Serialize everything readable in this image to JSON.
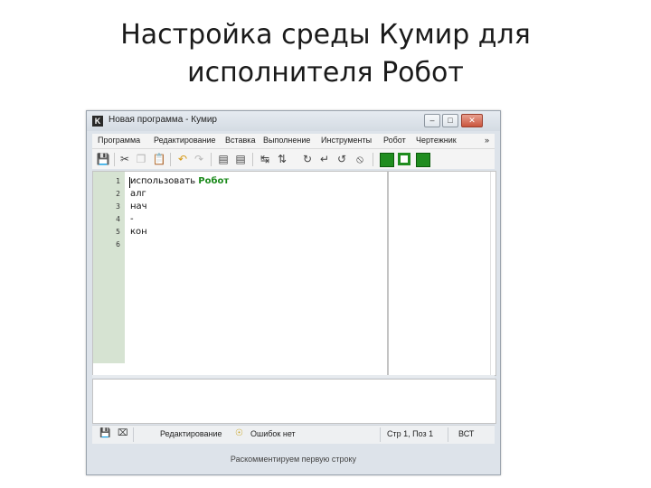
{
  "slide": {
    "title_line1": "Настройка среды Кумир для",
    "title_line2": "исполнителя Робот"
  },
  "window": {
    "title": "Новая программа - Кумир",
    "icon_letter": "K",
    "controls": {
      "minimize": "–",
      "maximize": "□",
      "close": "✕"
    }
  },
  "menu": [
    "Программа",
    "Редактирование",
    "Вставка",
    "Выполнение",
    "Инструменты",
    "Робот",
    "Чертежник",
    "»"
  ],
  "toolbar": {
    "icons": [
      "save-icon",
      "cut-icon",
      "copy-icon",
      "paste-icon",
      "undo-icon",
      "redo-icon",
      "doc-icon",
      "doc2-icon",
      "run-step-icon",
      "run-list-icon",
      "step-over-icon",
      "step-in-icon",
      "step-out-icon",
      "stop-icon",
      "robot-grid-icon",
      "robot-field-icon",
      "robot-panel-icon"
    ]
  },
  "editor": {
    "line_numbers": [
      "1",
      "2",
      "3",
      "4",
      "5",
      "6"
    ],
    "lines": [
      {
        "text": "использовать ",
        "keyword": "Робот"
      },
      {
        "text": "алг",
        "keyword": ""
      },
      {
        "text": "нач",
        "keyword": ""
      },
      {
        "text": "-",
        "keyword": ""
      },
      {
        "text": "кон",
        "keyword": ""
      },
      {
        "text": "",
        "keyword": ""
      }
    ]
  },
  "status": {
    "mode": "Редактирование",
    "errors": "Ошибок нет",
    "position": "Стр 1, Поз 1",
    "insert_mode": "ВСТ"
  },
  "hint": "Раскомментируем первую строку",
  "colors": {
    "gutter": "#d6e3d2",
    "keyword_green": "#1b8a1b",
    "robot_button": "#1f8c1f"
  }
}
